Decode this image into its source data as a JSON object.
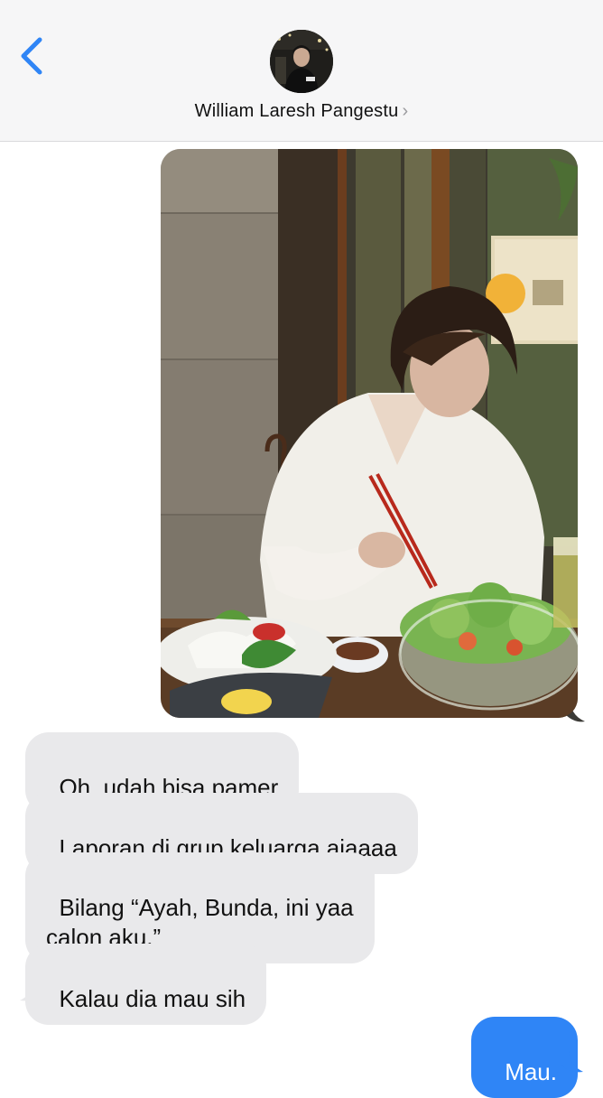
{
  "header": {
    "contact_name": "William Laresh Pangestu",
    "back_icon": "chevron-left-icon",
    "disclosure_icon": "chevron-right-icon"
  },
  "messages": [
    {
      "type": "image",
      "direction": "outgoing"
    },
    {
      "type": "text",
      "direction": "incoming",
      "text": "Oh, udah bisa pamer"
    },
    {
      "type": "text",
      "direction": "incoming",
      "text": "Laporan di grup keluarga ajaaaa"
    },
    {
      "type": "text",
      "direction": "incoming",
      "text": "Bilang “Ayah, Bunda, ini yaa\ncalon aku.”"
    },
    {
      "type": "text",
      "direction": "incoming",
      "text": "Kalau dia mau sih"
    },
    {
      "type": "text",
      "direction": "outgoing",
      "text": "Mau."
    }
  ],
  "colors": {
    "accent": "#2f85f6",
    "incoming_bubble": "#e9e9eb",
    "header_bg": "#f6f6f7"
  }
}
